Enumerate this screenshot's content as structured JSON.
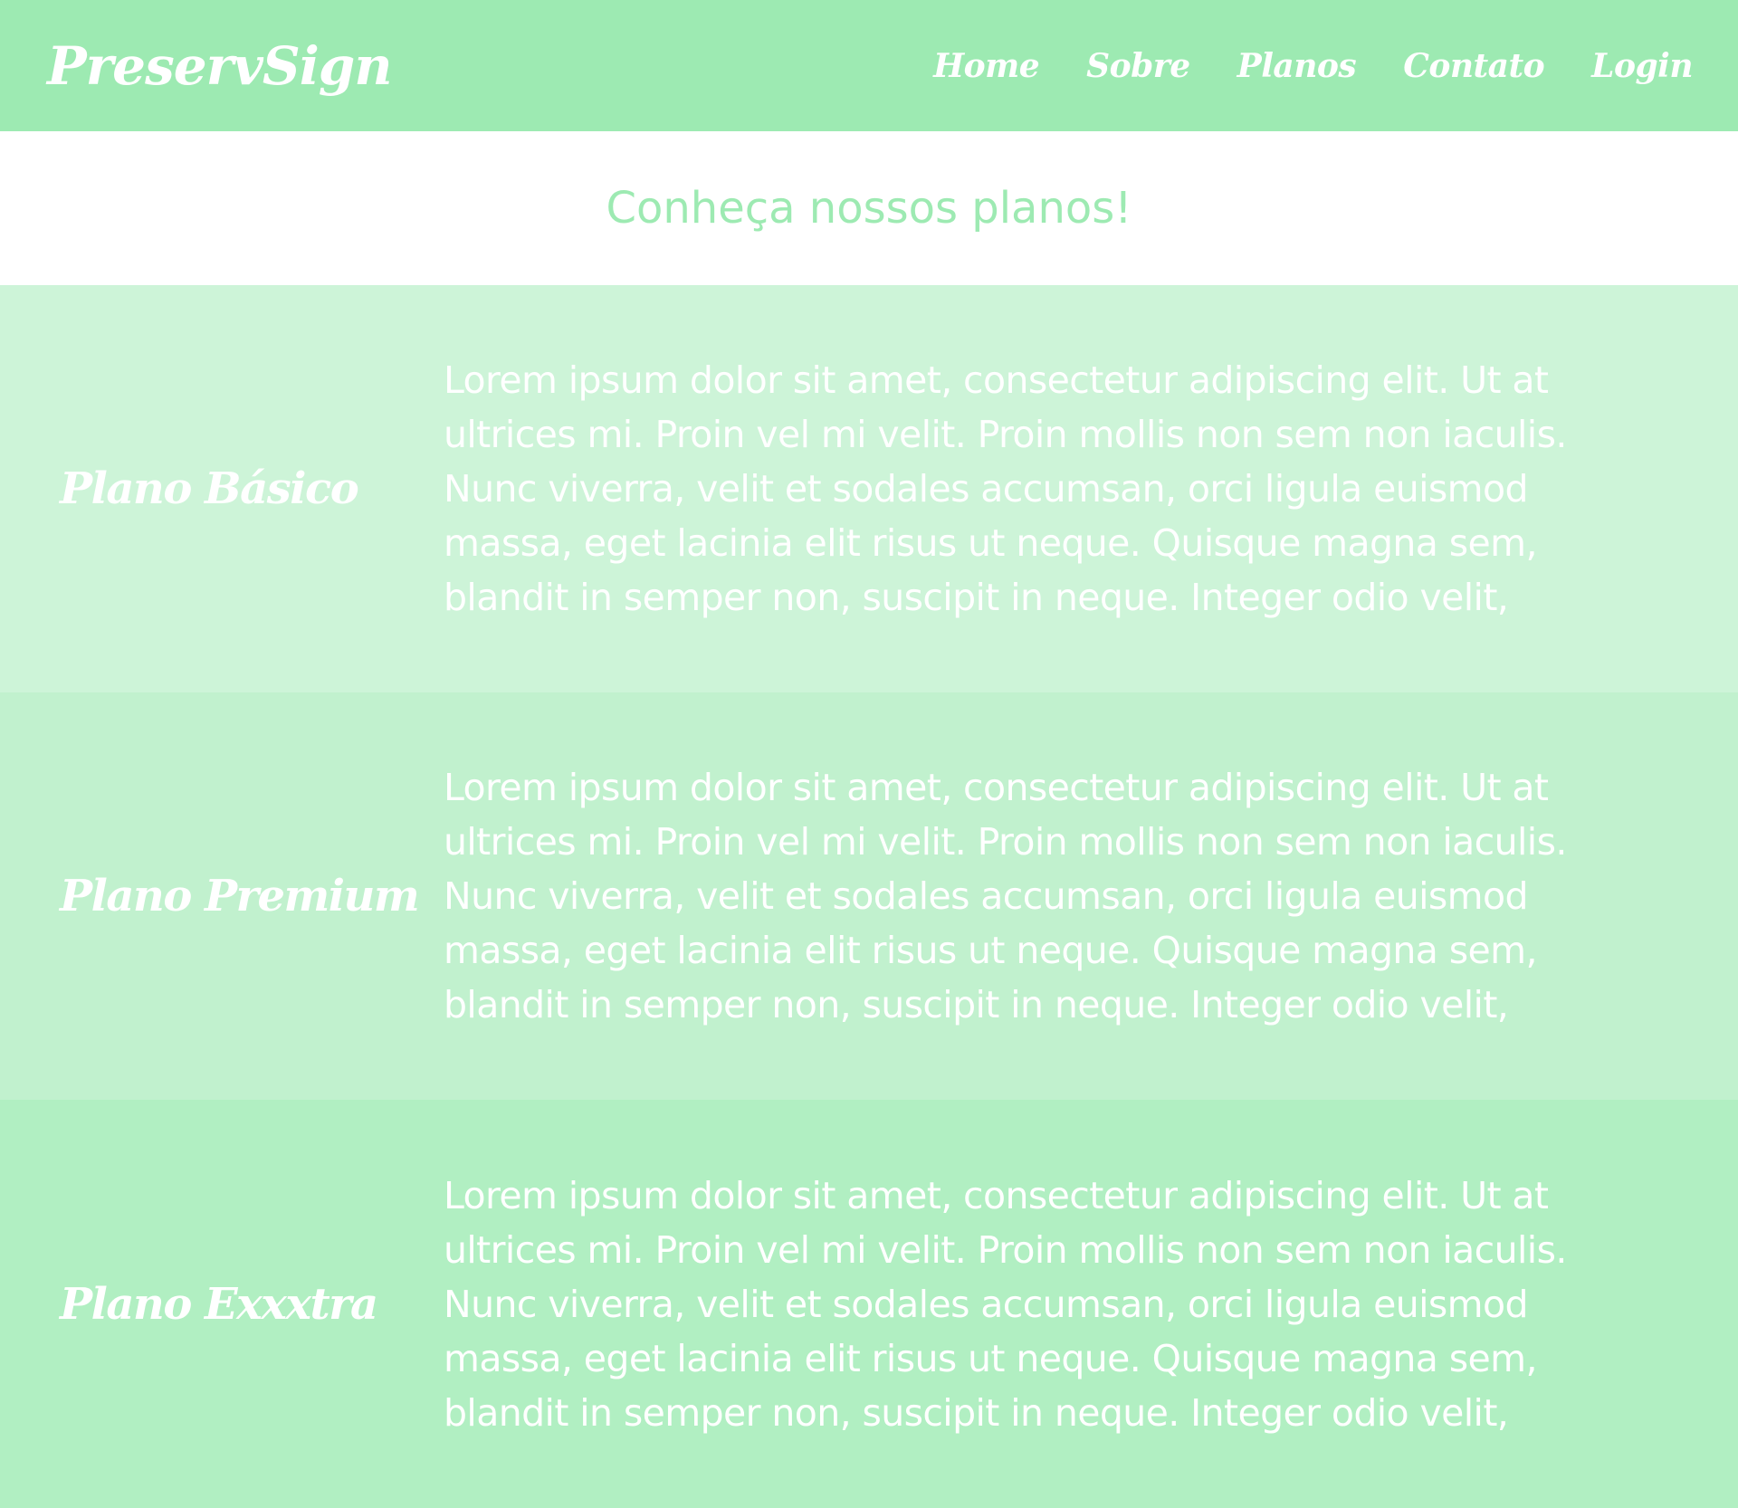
{
  "navbar": {
    "brand": "PreservSign",
    "links": [
      "Home",
      "Sobre",
      "Planos",
      "Contato",
      "Login"
    ]
  },
  "hero": {
    "title": "Conheça nossos planos!"
  },
  "plans": [
    {
      "name": "Plano Básico",
      "description": "Lorem ipsum dolor sit amet, consectetur adipiscing elit. Ut at ultrices mi. Proin vel mi velit. Proin mollis non sem non iaculis. Nunc viverra, velit et sodales accumsan, orci ligula euismod massa, eget lacinia elit risus ut neque. Quisque magna sem, blandit in semper non, suscipit in neque. Integer odio velit,"
    },
    {
      "name": "Plano Premium",
      "description": "Lorem ipsum dolor sit amet, consectetur adipiscing elit. Ut at ultrices mi. Proin vel mi velit. Proin mollis non sem non iaculis. Nunc viverra, velit et sodales accumsan, orci ligula euismod massa, eget lacinia elit risus ut neque. Quisque magna sem, blandit in semper non, suscipit in neque. Integer odio velit,"
    },
    {
      "name": "Plano Exxxtra",
      "description": "Lorem ipsum dolor sit amet, consectetur adipiscing elit. Ut at ultrices mi. Proin vel mi velit. Proin mollis non sem non iaculis. Nunc viverra, velit et sodales accumsan, orci ligula euismod massa, eget lacinia elit risus ut neque. Quisque magna sem, blandit in semper non, suscipit in neque. Integer odio velit,"
    }
  ],
  "colors": {
    "brand_green": "#9deab2",
    "plan_1_bg": "#cdf4d8",
    "plan_2_bg": "#c1f1ce",
    "plan_3_bg": "#b1efc2",
    "text_on_green": "#ffffff"
  }
}
